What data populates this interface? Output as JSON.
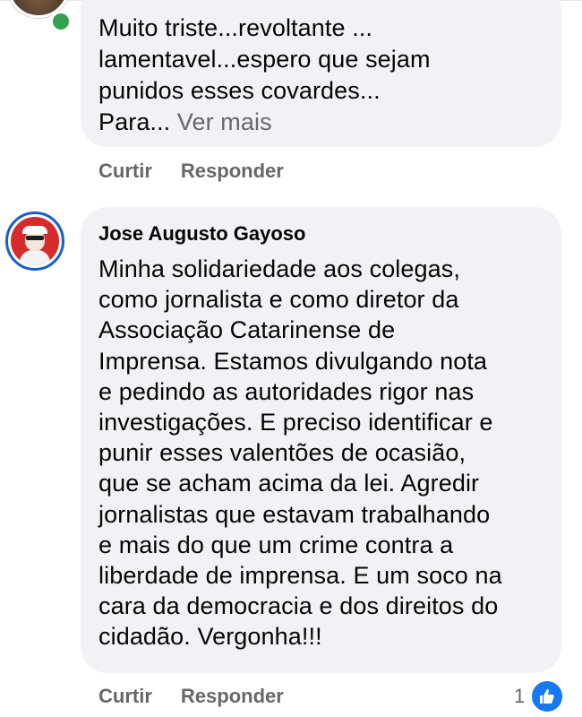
{
  "comments": [
    {
      "author": "",
      "lines": [
        "Muito triste...revoltante ...",
        "lamentavel...espero que sejam",
        "punidos esses covardes..."
      ],
      "last_line": "Para...",
      "see_more": "Ver mais",
      "online": true,
      "actions": {
        "like": "Curtir",
        "reply": "Responder"
      }
    },
    {
      "author": "Jose Augusto Gayoso",
      "lines": [
        "Minha solidariedade aos colegas,",
        "como jornalista e como diretor da",
        "Associação Catarinense de",
        "Imprensa. Estamos divulgando nota",
        "e pedindo as autoridades rigor nas",
        "investigações.  E preciso identificar e",
        "punir esses valentões de ocasião,",
        "que se acham acima da lei. Agredir",
        "jornalistas que estavam trabalhando",
        "e mais do que um crime contra a",
        "liberdade de imprensa. E um soco na",
        "cara da democracia e dos direitos do",
        "cidadão. Vergonha!!!"
      ],
      "actions": {
        "like": "Curtir",
        "reply": "Responder"
      },
      "reaction_count": "1",
      "reaction_icon": "like-icon"
    }
  ],
  "colors": {
    "bubble": "#f0f2f5",
    "secondary_text": "#65676b",
    "like_blue": "#1877f2",
    "online_green": "#31a24c"
  }
}
